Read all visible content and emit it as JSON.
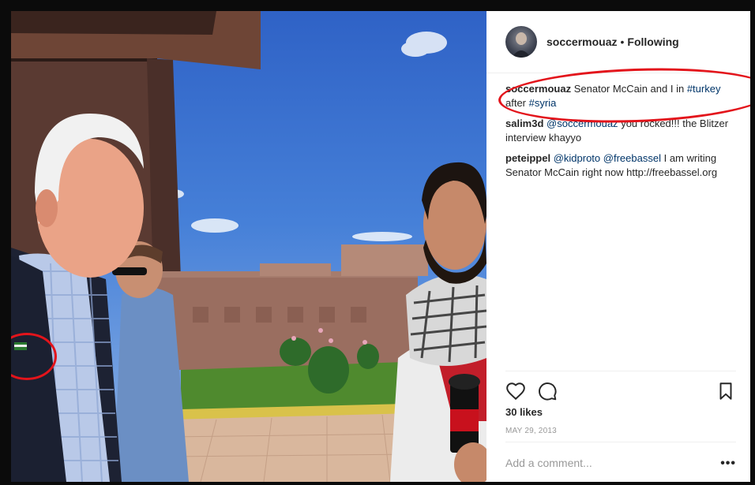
{
  "post": {
    "author": "soccermouaz",
    "separator": "•",
    "follow_status": "Following",
    "avatar_icon": "profile-photo",
    "caption": {
      "user": "soccermouaz",
      "text_before": "Senator McCain and I in",
      "hashtag1": "#turkey",
      "text_middle": "after",
      "hashtag2": "#syria"
    },
    "comments": [
      {
        "user": "salim3d",
        "mention": "@soccermouaz",
        "text": "you rocked!!! the Blitzer interview khayyo"
      },
      {
        "user": "peteippel",
        "mention1": "@kidproto",
        "mention2": "@freebassel",
        "text": "I am writing Senator McCain right now http://freebassel.org"
      }
    ],
    "likes": "30 likes",
    "date": "MAY 29, 2013",
    "comment_placeholder": "Add a comment...",
    "more_label": "•••"
  },
  "icons": {
    "like": "heart-icon",
    "comment": "comment-bubble-icon",
    "save": "bookmark-icon",
    "more": "more-options-icon"
  },
  "colors": {
    "annotation_red": "#e3141b",
    "link": "#003569",
    "muted": "#999999",
    "text": "#262626"
  }
}
